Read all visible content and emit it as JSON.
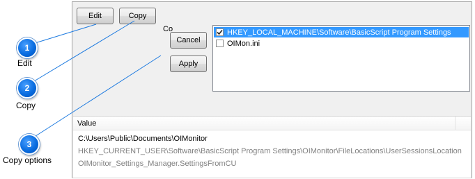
{
  "toolbar": {
    "edit_label": "Edit",
    "copy_label": "Copy"
  },
  "dialog": {
    "obscured_label": "Co",
    "cancel_label": "Cancel",
    "apply_label": "Apply",
    "list_items": [
      {
        "label": "HKEY_LOCAL_MACHINE\\Software\\BasicScript Program Settings",
        "checked": true,
        "selected": true
      },
      {
        "label": "OIMon.ini",
        "checked": false,
        "selected": false
      }
    ]
  },
  "grid": {
    "column_header": "Value",
    "rows": [
      "C:\\Users\\Public\\Documents\\OIMonitor",
      "HKEY_CURRENT_USER\\Software\\BasicScript Program Settings\\OIMonitor\\FileLocations\\UserSessionsLocation",
      "OIMonitor_Settings_Manager.SettingsFromCU"
    ]
  },
  "callouts": [
    {
      "number": "1",
      "label": "Edit"
    },
    {
      "number": "2",
      "label": "Copy"
    },
    {
      "number": "3",
      "label": "Copy options"
    }
  ],
  "colors": {
    "callout_blue": "#0a6de0",
    "selection_blue": "#3399ff",
    "connector_blue": "#1e7be0"
  }
}
